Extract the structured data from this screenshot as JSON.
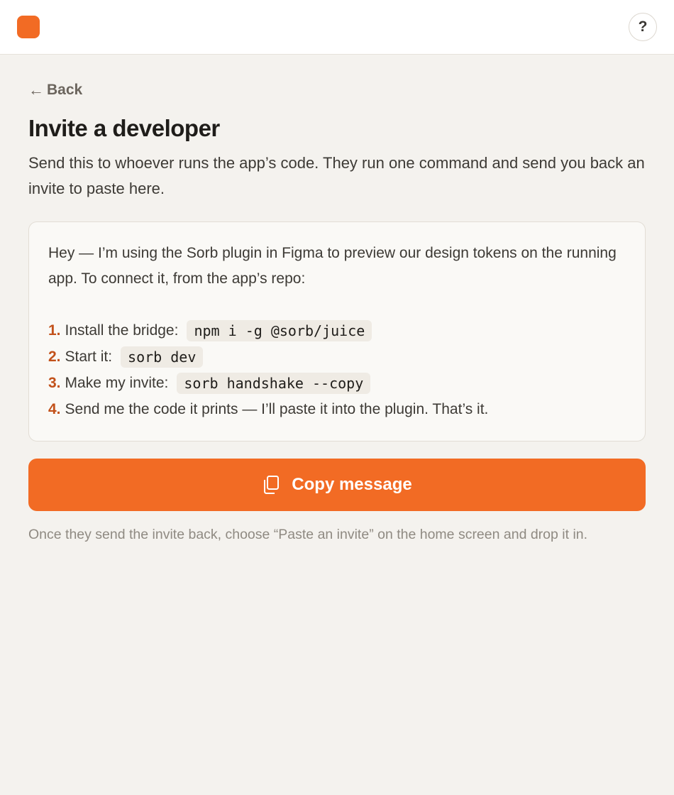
{
  "header": {
    "help_label": "?"
  },
  "nav": {
    "back_arrow": "←",
    "back_label": "Back"
  },
  "page": {
    "title": "Invite a developer",
    "description": "Send this to whoever runs the app’s code. They run one command and send you back an invite to paste here."
  },
  "message": {
    "intro": "Hey — I’m using the Sorb plugin in Figma to preview our design tokens on the running app. To connect it, from the app’s repo:",
    "steps": [
      {
        "number": "1.",
        "text": "Install the bridge:",
        "code": "npm i -g @sorb/juice"
      },
      {
        "number": "2.",
        "text": "Start it:",
        "code": "sorb dev"
      },
      {
        "number": "3.",
        "text": "Make my invite:",
        "code": "sorb handshake --copy"
      },
      {
        "number": "4.",
        "text": "Send me the code it prints — I’ll paste it into the plugin. That’s it.",
        "code": ""
      }
    ]
  },
  "actions": {
    "copy_label": "Copy message",
    "copy_icon": "copy-icon"
  },
  "hint": "Once they send the invite back, choose “Paste an invite” on the home screen and drop it in.",
  "colors": {
    "accent": "#f26b24",
    "step_number": "#c2511a",
    "background": "#f4f2ee"
  }
}
